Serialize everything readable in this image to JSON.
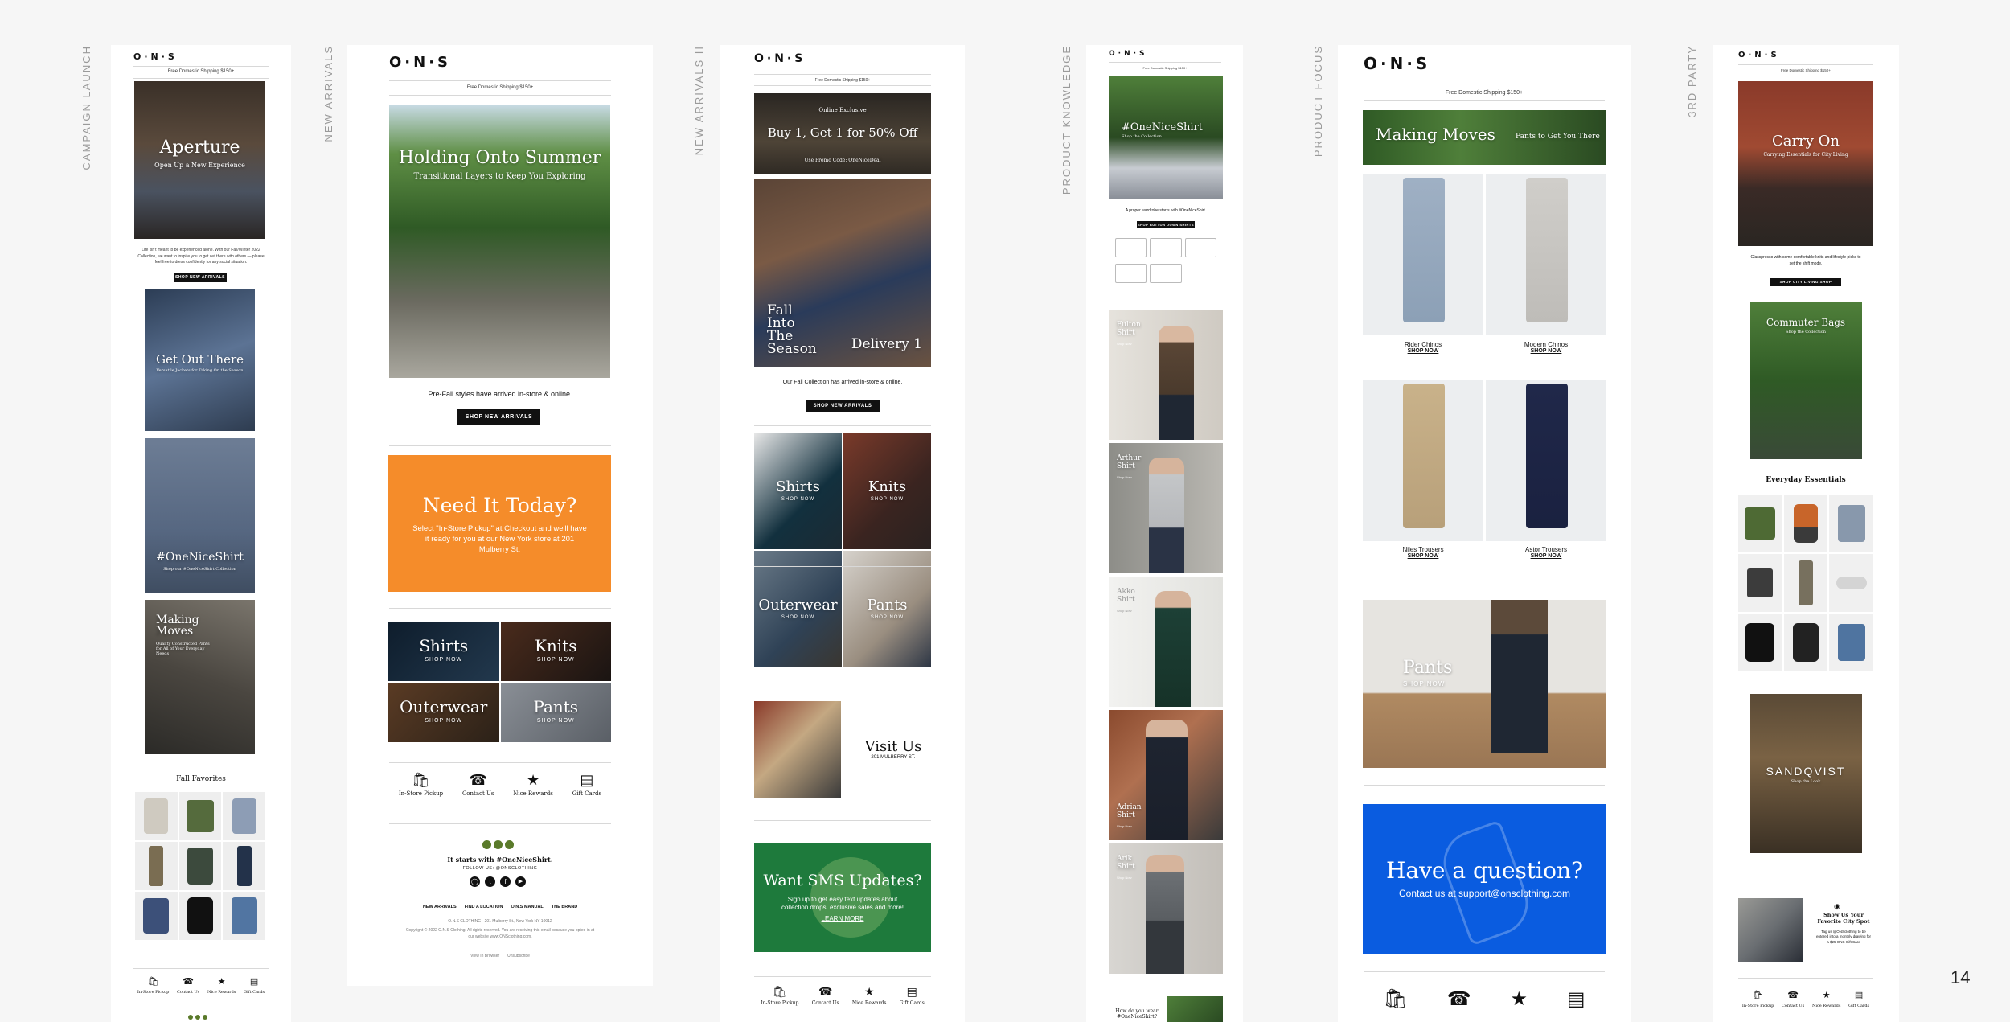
{
  "page_number": "14",
  "labels": [
    "CAMPAIGN LAUNCH",
    "NEW ARRIVALS",
    "NEW ARRIVALS II",
    "PRODUCT KNOWLEDGE",
    "PRODUCT FOCUS",
    "3RD PARTY"
  ],
  "brand": "O·N·S",
  "shipping": "Free Domestic Shipping $150+",
  "e1": {
    "hero_title": "Aperture",
    "hero_sub": "Open Up a New Experience",
    "body": "Life isn't meant to be experienced alone. With our Fall/Winter 2022 Collection, we want to inspire you to get out there with others — please feel free to dress confidently for any social situation.",
    "cta": "SHOP NEW ARRIVALS",
    "tile1_title": "Get Out There",
    "tile1_sub": "Versatile Jackets for Taking On the Season",
    "tile2_title": "#OneNiceShirt",
    "tile2_sub": "Shop our #OneNiceShirt Collection",
    "tile3_title": "Making Moves",
    "tile3_sub": "Quality Constructed Pants for All of Your Everyday Needs",
    "favorites": "Fall Favorites",
    "icons": [
      "In-Store Pickup",
      "Contact Us",
      "Nice Rewards",
      "Gift Cards"
    ]
  },
  "e2": {
    "hero_title": "Holding Onto Summer",
    "hero_sub": "Transitional Layers to Keep You Exploring",
    "body": "Pre-Fall styles have arrived in-store & online.",
    "cta": "SHOP NEW ARRIVALS",
    "promo_title": "Need It Today?",
    "promo_body": "Select \"In-Store Pickup\" at Checkout and we'll have it ready for you at our New York store at 201 Mulberry St.",
    "cats": [
      "Shirts",
      "Knits",
      "Outerwear",
      "Pants"
    ],
    "shop_now": "SHOP NOW",
    "icons": [
      "In-Store Pickup",
      "Contact Us",
      "Nice Rewards",
      "Gift Cards"
    ],
    "social_title": "It starts with #OneNiceShirt.",
    "follow": "FOLLOW US: @ONSCLOTHING",
    "footer_links": [
      "NEW ARRIVALS",
      "FIND A LOCATION",
      "O.N.S MANUAL",
      "THE BRAND"
    ],
    "address": "O.N.S CLOTHING · 201 Mulberry St., New York NY 10012",
    "copyright": "Copyright © 2022 O.N.S Clothing. All rights reserved. You are receiving this email because you opted in at our website www.ONSclothing.com.",
    "view_browser": "View In Browser",
    "unsubscribe": "Unsubscribe"
  },
  "e3": {
    "promo_eyebrow": "Online Exclusive",
    "promo_title": "Buy 1, Get 1 for 50% Off",
    "promo_code": "Use Promo Code: OneNiceDeal",
    "hero_title": "Fall Into The Season",
    "hero_title2": "Delivery 1",
    "body": "Our Fall Collection has arrived in-store & online.",
    "cta": "SHOP NEW ARRIVALS",
    "cats": [
      "Shirts",
      "Knits",
      "Outerwear",
      "Pants"
    ],
    "shop_now": "SHOP NOW",
    "visit_title": "Visit Us",
    "visit_addr": "201 MULBERRY ST.",
    "sms_title": "Want SMS Updates?",
    "sms_body": "Sign up to get easy text updates about collection drops, exclusive sales and more!",
    "sms_link": "LEARN MORE",
    "icons": [
      "In-Store Pickup",
      "Contact Us",
      "Nice Rewards",
      "Gift Cards"
    ]
  },
  "e4": {
    "hero_title": "#OneNiceShirt",
    "hero_sub": "Shop the Collection",
    "body": "A proper wardrobe starts with #OneNiceShirt.",
    "cta": "SHOP BUTTON DOWN SHIRTS",
    "products": [
      {
        "name": "Fulton Shirt",
        "link": "Shop Now"
      },
      {
        "name": "Arthur Shirt",
        "link": "Shop Now"
      },
      {
        "name": "Akko Shirt",
        "link": "Shop Now"
      },
      {
        "name": "Adrian Shirt",
        "link": "Shop Now"
      },
      {
        "name": "Arik Shirt",
        "link": "Shop Now"
      }
    ],
    "bottom": "How do you wear #OneNiceShirt?"
  },
  "e5": {
    "banner_left": "Making Moves",
    "banner_right": "Pants to Get You There",
    "products": [
      {
        "name": "Rider Chinos",
        "link": "SHOP NOW"
      },
      {
        "name": "Modern Chinos",
        "link": "SHOP NOW"
      },
      {
        "name": "Niles Trousers",
        "link": "SHOP NOW"
      },
      {
        "name": "Astor Trousers",
        "link": "SHOP NOW"
      }
    ],
    "feature_title": "Pants",
    "feature_link": "SHOP NOW",
    "question_title": "Have a question?",
    "question_body": "Contact us at support@onsclothing.com"
  },
  "e6": {
    "hero_title": "Carry On",
    "hero_sub": "Carrying Essentials for City Living",
    "body": "Glasspresso with some comfortable knits and lifestyle picks to set the shift mode.",
    "cta": "SHOP CITY LIVING SHOP",
    "tile_title": "Commuter Bags",
    "tile_sub": "Shop the Collection",
    "essentials": "Everyday Essentials",
    "brand_tile": "SANDQVIST",
    "brand_sub": "Shop the Look",
    "spot_title": "Show Us Your Favorite City Spot",
    "spot_body": "Tag us @ONSclothing to be entered into a monthly drawing for a $25 ONS Gift Card",
    "icons": [
      "In-Store Pickup",
      "Contact Us",
      "Nice Rewards",
      "Gift Cards"
    ]
  },
  "colors": {
    "orange": "#f58c2a",
    "sms_green": "#1e7a3c",
    "blue": "#0a5ce0",
    "dark": "#111111"
  }
}
